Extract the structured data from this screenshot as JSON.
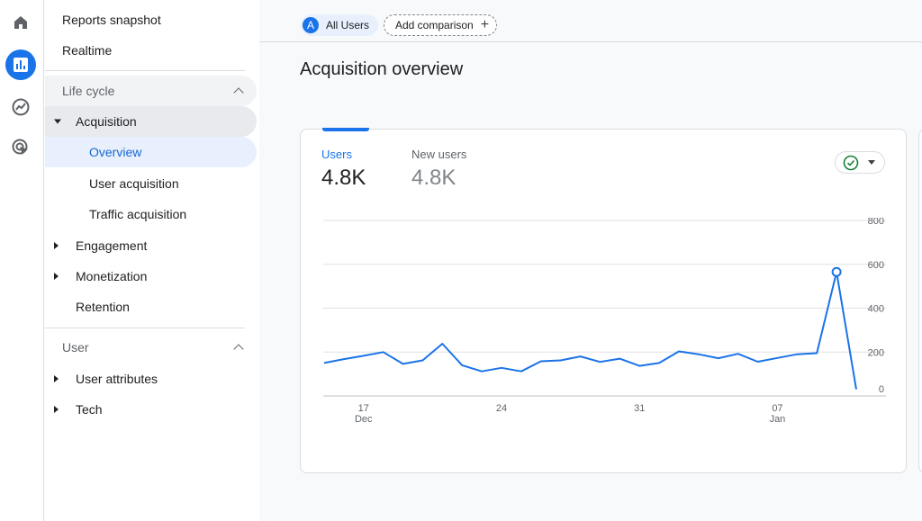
{
  "rail": {
    "items": [
      {
        "icon": "home-icon",
        "active": false
      },
      {
        "icon": "reports-icon",
        "active": true
      },
      {
        "icon": "explore-icon",
        "active": false
      },
      {
        "icon": "advertising-icon",
        "active": false
      }
    ]
  },
  "nav": {
    "reports_snapshot": "Reports snapshot",
    "realtime": "Realtime",
    "lifecycle": {
      "title": "Life cycle",
      "acquisition": "Acquisition",
      "overview": "Overview",
      "user_acquisition": "User acquisition",
      "traffic_acquisition": "Traffic acquisition",
      "engagement": "Engagement",
      "monetization": "Monetization",
      "retention": "Retention"
    },
    "user": {
      "title": "User",
      "user_attributes": "User attributes",
      "tech": "Tech"
    }
  },
  "header": {
    "segment_avatar": "A",
    "segment_label": "All Users",
    "add_comparison": "Add comparison",
    "add_symbol": "+"
  },
  "page_title": "Acquisition overview",
  "card": {
    "metrics": [
      {
        "label": "Users",
        "value": "4.8K",
        "active": true
      },
      {
        "label": "New users",
        "value": "4.8K",
        "active": false
      }
    ],
    "accent_color": "#1a73e8"
  },
  "chart_data": {
    "type": "line",
    "y_ticks": [
      "800",
      "600",
      "400",
      "200",
      "0"
    ],
    "ylim": [
      0,
      800
    ],
    "x_ticks": [
      {
        "day": "17",
        "month": "Dec",
        "index": 2
      },
      {
        "day": "24",
        "month": "",
        "index": 9
      },
      {
        "day": "31",
        "month": "",
        "index": 16
      },
      {
        "day": "07",
        "month": "Jan",
        "index": 23
      }
    ],
    "series": [
      {
        "color": "#1a73e8",
        "values": [
          150,
          168,
          183,
          200,
          146,
          162,
          238,
          140,
          112,
          128,
          112,
          158,
          162,
          180,
          155,
          170,
          137,
          150,
          203,
          190,
          172,
          192,
          156,
          173,
          190,
          195,
          565,
          30
        ],
        "highlight_index": 26
      }
    ],
    "grid": true
  }
}
